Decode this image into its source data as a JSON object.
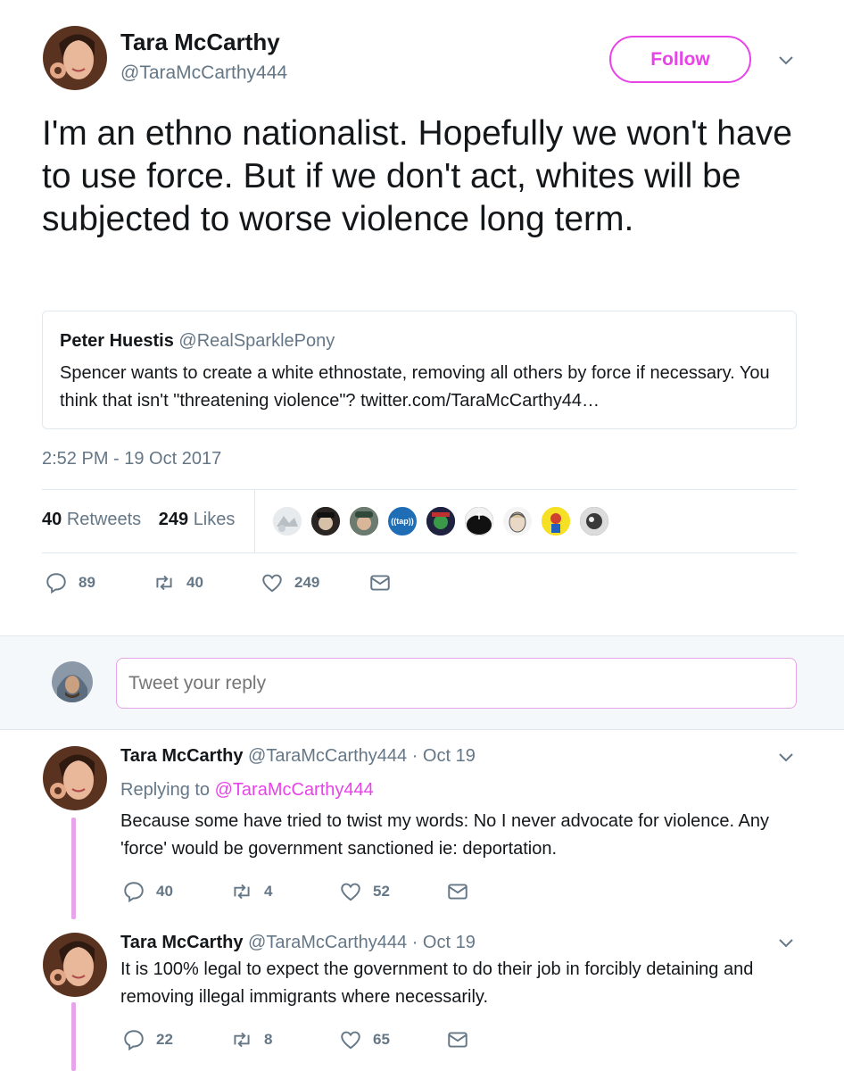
{
  "tweet": {
    "author_name": "Tara McCarthy",
    "author_handle": "@TaraMcCarthy444",
    "follow_label": "Follow",
    "text": "I'm an ethno nationalist. Hopefully we won't have to use force. But if we don't act, whites will be subjected to worse violence long term.",
    "quote": {
      "name": "Peter Huestis",
      "handle": "@RealSparklePony",
      "text": "Spencer wants to create a white ethnostate, removing all others by force if necessary. You think that isn't \"threatening violence\"? twitter.com/TaraMcCarthy44…"
    },
    "timestamp": "2:52 PM - 19 Oct 2017",
    "retweets_count": "40",
    "retweets_label": "Retweets",
    "likes_count": "249",
    "likes_label": "Likes",
    "actions": {
      "replies": "89",
      "retweets": "40",
      "likes": "249"
    },
    "likers_icons": [
      "liker-avatar-1",
      "liker-avatar-2",
      "liker-avatar-3",
      "liker-avatar-tap",
      "liker-avatar-5",
      "liker-avatar-6",
      "liker-avatar-7",
      "liker-avatar-8",
      "liker-avatar-9"
    ],
    "liker_tap_text": "((tap))"
  },
  "reply_box": {
    "placeholder": "Tweet your reply"
  },
  "replies": [
    {
      "name": "Tara McCarthy",
      "handle_date": "@TaraMcCarthy444 · Oct 19",
      "replying_prefix": "Replying to",
      "replying_to": "@TaraMcCarthy444",
      "text": "Because some have tried to twist my words: No I never advocate for violence. Any 'force' would be government sanctioned ie: deportation.",
      "replies": "40",
      "retweets": "4",
      "likes": "52"
    },
    {
      "name": "Tara McCarthy",
      "handle_date": "@TaraMcCarthy444 · Oct 19",
      "text": "It is 100% legal to expect the government to do their job in forcibly detaining and removing illegal immigrants where necessarily.",
      "replies": "22",
      "retweets": "8",
      "likes": "65"
    }
  ],
  "colors": {
    "accent": "#e843e8",
    "thread": "#e6a4ea",
    "muted": "#657786",
    "text": "#14171a",
    "border": "#e1e8ed"
  }
}
